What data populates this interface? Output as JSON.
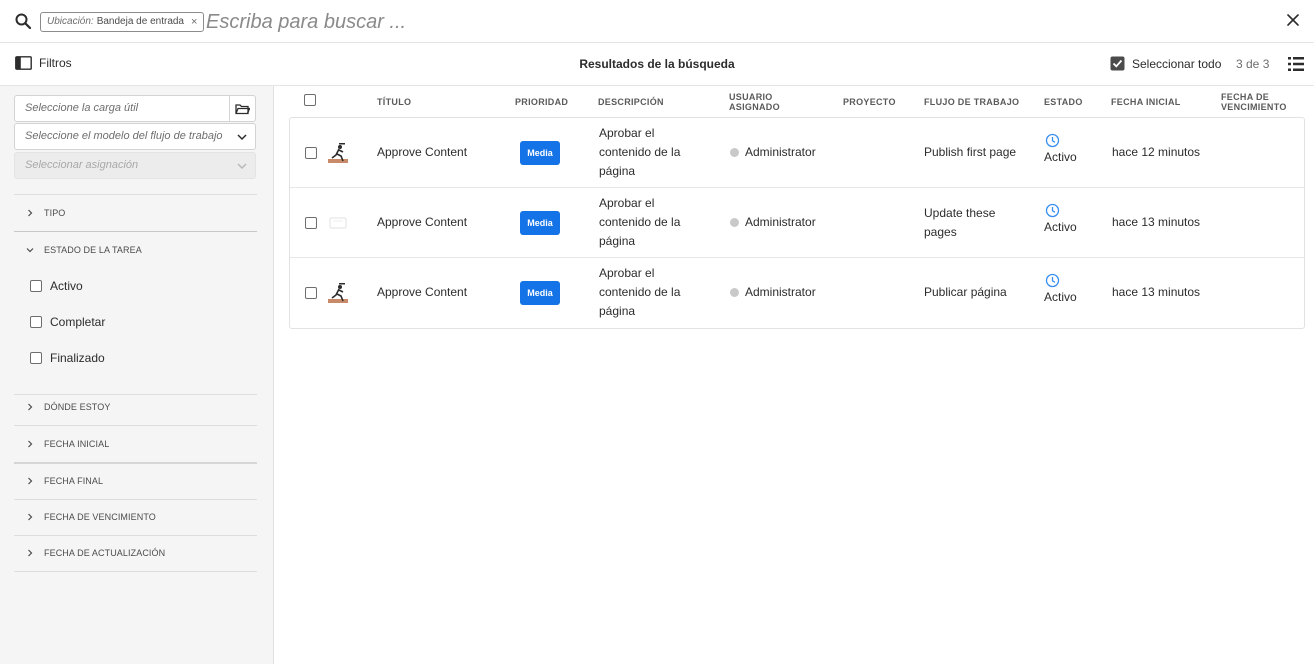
{
  "search": {
    "tag_key": "Ubicación:",
    "tag_value": "Bandeja de entrada",
    "placeholder": "Escriba para buscar ..."
  },
  "toolbar": {
    "filters_label": "Filtros",
    "results_title": "Resultados de la búsqueda",
    "select_all_label": "Seleccionar todo",
    "count": "3 de 3"
  },
  "rail": {
    "payload_placeholder": "Seleccione la carga útil",
    "model_placeholder": "Seleccione el modelo del flujo de trabajo",
    "assignment_placeholder": "Seleccionar asignación",
    "sections": [
      {
        "label": "TIPO"
      },
      {
        "label": "ESTADO DE LA TAREA"
      },
      {
        "label": "DÓNDE ESTOY"
      },
      {
        "label": "FECHA INICIAL"
      },
      {
        "label": "FECHA FINAL"
      },
      {
        "label": "FECHA DE VENCIMIENTO"
      },
      {
        "label": "FECHA DE ACTUALIZACIÓN"
      }
    ],
    "status_options": [
      "Activo",
      "Completar",
      "Finalizado"
    ]
  },
  "table": {
    "headers": {
      "title": "TÍTULO",
      "priority": "PRIORIDAD",
      "description": "DESCRIPCIÓN",
      "assignee_1": "USUARIO",
      "assignee_2": "ASIGNADO",
      "project": "PROYECTO",
      "workflow": "FLUJO DE TRABAJO",
      "status": "ESTADO",
      "start": "FECHA INICIAL",
      "due_1": "FECHA DE",
      "due_2": "VENCIMIENTO"
    },
    "rows": [
      {
        "title": "Approve Content",
        "priority": "Media",
        "desc_1": "Aprobar el",
        "desc_2": "contenido de la",
        "desc_3": "página",
        "assignee": "Administrator",
        "workflow_1": "Publish first page",
        "workflow_2": "",
        "status": "Activo",
        "start": "hace 12 minutos",
        "thumb": "runner-image"
      },
      {
        "title": "Approve Content",
        "priority": "Media",
        "desc_1": "Aprobar el",
        "desc_2": "contenido de la",
        "desc_3": "página",
        "assignee": "Administrator",
        "workflow_1": "Update these",
        "workflow_2": "pages",
        "status": "Activo",
        "start": "hace 13 minutos",
        "thumb": "placeholder-image"
      },
      {
        "title": "Approve Content",
        "priority": "Media",
        "desc_1": "Aprobar el",
        "desc_2": "contenido de la",
        "desc_3": "página",
        "assignee": "Administrator",
        "workflow_1": "Publicar página",
        "workflow_2": "",
        "status": "Activo",
        "start": "hace 13 minutos",
        "thumb": "runner-image"
      }
    ]
  },
  "colors": {
    "accent": "#1473e6",
    "status_icon": "#378ef0"
  }
}
